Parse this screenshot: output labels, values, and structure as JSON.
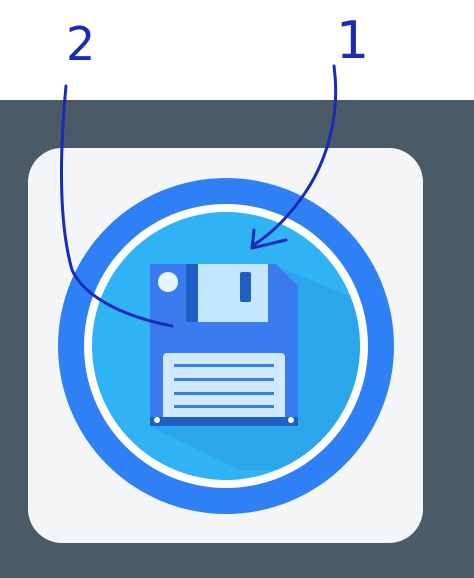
{
  "annotations": {
    "label_1": "1",
    "label_2": "2",
    "ink_color": "#1a2bb8"
  },
  "icon": {
    "name": "save-floppy-disk-icon",
    "outer_ring_color": "#2f80f5",
    "inner_ring_color": "#ffffff",
    "disk_circle_color": "#2fb3f5",
    "disk_body_color": "#3a7cf0",
    "label_area_color": "#cfe9ff",
    "shutter_color": "#bfe4ff",
    "accent_dark": "#1f5fc4"
  },
  "colors": {
    "background_top": "#ffffff",
    "background_bottom": "#4a5b67",
    "card": "#f4f5f7"
  }
}
